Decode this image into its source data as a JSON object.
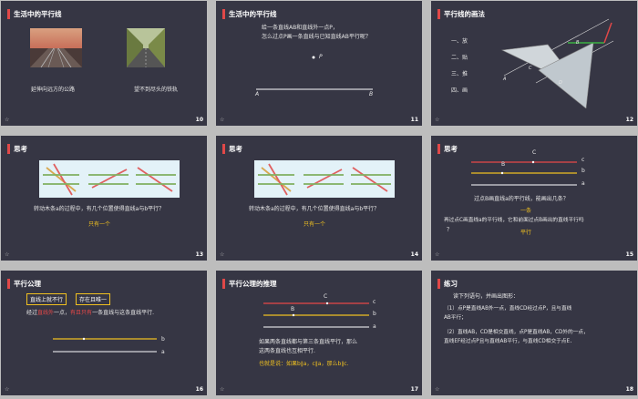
{
  "slides": [
    {
      "num": "10",
      "title": "生活中的平行线",
      "caption_left": "延伸向远方的公路",
      "caption_right": "望不到尽头的铁轨"
    },
    {
      "num": "11",
      "title": "生活中的平行线",
      "line1": "给一条直线AB和直线外一点P，",
      "line2": "怎么过点P画一条直线与已知直线AB平行呢？",
      "point_p": "P",
      "label_a": "A",
      "label_b": "B"
    },
    {
      "num": "12",
      "title": "平行线的画法",
      "steps": [
        "一、放",
        "二、贴",
        "三、推",
        "四、画"
      ],
      "label_a": "A",
      "label_b": "B",
      "label_c": "C",
      "label_d": "D"
    },
    {
      "num": "13",
      "title": "思考",
      "question": "转动木条a的过程中，有几个位置使得直线a与b平行？",
      "answer": "只有一个"
    },
    {
      "num": "14",
      "title": "思考",
      "question": "转动木条a的过程中，有几个位置使得直线a与b平行？",
      "answer": "只有一个"
    },
    {
      "num": "15",
      "title": "思考",
      "label_c": "C",
      "label_b": "B",
      "lines": [
        "c",
        "b",
        "a"
      ],
      "q1": "过点B画直线a的平行线，能画出几条？",
      "a1": "一条",
      "q2": "再过点C画直线a的平行线，它和前面过点B画出的直线平行吗",
      "q2b": "？",
      "a2": "平行"
    },
    {
      "num": "16",
      "title": "平行公理",
      "box1": "直线上就不行",
      "box2": "存在且唯一",
      "text_pre": "经过",
      "text_red1": "直线外",
      "text_mid": "一点，",
      "text_red2": "有且只有",
      "text_post": "一条直线与这条直线平行.",
      "line_b": "b",
      "line_a": "a"
    },
    {
      "num": "17",
      "title": "平行公理的推理",
      "label_c": "C",
      "label_b": "B",
      "lines": [
        "c",
        "b",
        "a"
      ],
      "text1": "如果两条直线都与第三条直线平行，那么",
      "text2": "这两条直线也互相平行.",
      "text3": "也就是说：如果b∥a，c∥a，那么b∥c."
    },
    {
      "num": "18",
      "title": "练习",
      "intro": "读下列语句，并画出图形：",
      "p1a": "（1）点P是直线AB外一点，直线CD经过点P，且与直线",
      "p1b": "AB平行；",
      "p2a": "（2）直线AB，CD是相交直线，点P是直线AB，CD外的一点，",
      "p2b": "直线EF经过点P且与直线AB平行，与直线CD相交于点E．"
    }
  ],
  "colors": {
    "slide_bg": "#363644",
    "accent_red": "#e04848",
    "accent_yellow": "#f0c020"
  },
  "icons": {
    "star": "☆"
  }
}
